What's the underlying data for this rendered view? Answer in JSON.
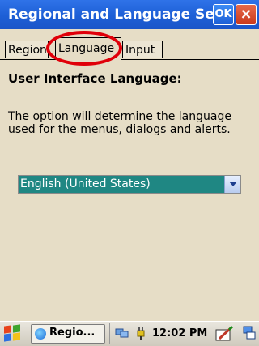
{
  "window": {
    "title": "Regional and Language Se...",
    "ok_label": "OK",
    "close_label": "×"
  },
  "tabs": [
    {
      "label": "Region"
    },
    {
      "label": "Language",
      "active": true
    },
    {
      "label": "Input"
    }
  ],
  "content": {
    "heading": "User Interface Language:",
    "description": "The option will determine the language used for the menus, dialogs and alerts.",
    "language_select": {
      "selected": "English (United States)"
    }
  },
  "taskbar": {
    "task_label": "Regio...",
    "clock": "12:02 PM"
  },
  "colors": {
    "title_bar": "#1d5fd6",
    "highlight_annotation": "#e0000a",
    "selection": "#1f8783",
    "background": "#e6ddc6"
  },
  "icons": [
    "windows-start-icon",
    "globe-icon",
    "network-icon",
    "plug-icon",
    "input-panel-icon",
    "switch-window-icon"
  ]
}
